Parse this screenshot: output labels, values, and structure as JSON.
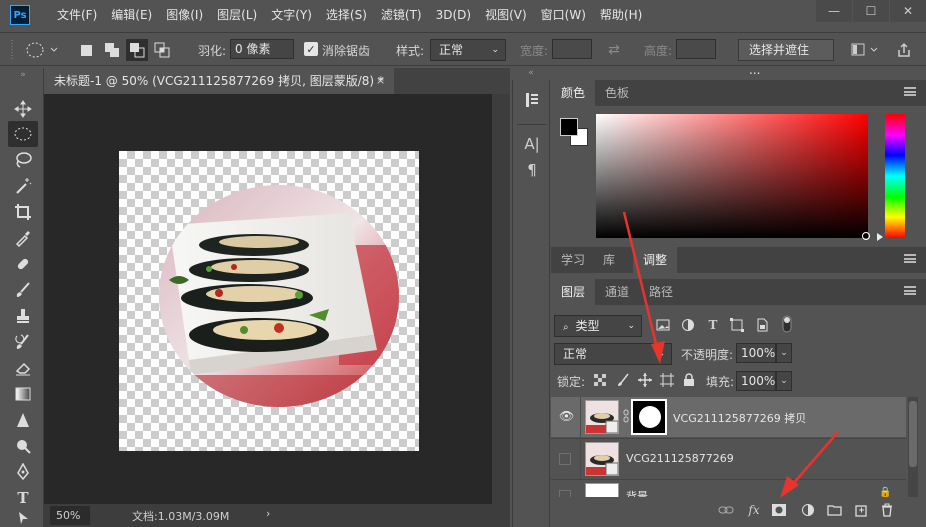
{
  "app": {
    "logo": "Ps"
  },
  "menu": [
    "文件(F)",
    "编辑(E)",
    "图像(I)",
    "图层(L)",
    "文字(Y)",
    "选择(S)",
    "滤镜(T)",
    "3D(D)",
    "视图(V)",
    "窗口(W)",
    "帮助(H)"
  ],
  "window_controls": {
    "minimize": "—",
    "maximize": "☐",
    "close": "✕"
  },
  "options": {
    "feather_label": "羽化:",
    "feather_value": "0 像素",
    "antialias_label": "消除锯齿",
    "antialias_checked": true,
    "style_label": "样式:",
    "style_value": "正常",
    "width_label": "宽度:",
    "height_label": "高度:",
    "select_mask_button": "选择并遮住 ..."
  },
  "document": {
    "tab_title": "未标题-1 @ 50% (VCG211125877269 拷贝, 图层蒙版/8) *",
    "close": "×",
    "zoom": "50%",
    "doc_info": "文档:1.03M/3.09M",
    "status_arrow": "›"
  },
  "color_panel": {
    "tabs": [
      "颜色",
      "色板"
    ],
    "active_tab": "颜色",
    "foreground": "#000000",
    "background": "#ffffff"
  },
  "learn_panel": {
    "tabs": [
      "学习",
      "库",
      "调整"
    ],
    "active_tab": "调整"
  },
  "layers_panel": {
    "tabs": [
      "图层",
      "通道",
      "路径"
    ],
    "active_tab": "图层",
    "filter_label": "类型",
    "blend_mode": "正常",
    "opacity_label": "不透明度:",
    "opacity_value": "100%",
    "lock_label": "锁定:",
    "fill_label": "填充:",
    "fill_value": "100%",
    "layers": [
      {
        "name": "VCG211125877269 拷贝",
        "visible": true,
        "has_mask": true,
        "selected": true
      },
      {
        "name": "VCG211125877269",
        "visible": false,
        "has_mask": false,
        "selected": false
      },
      {
        "name": "背景",
        "visible": false,
        "has_mask": false,
        "selected": false
      }
    ],
    "footer_icons": [
      "link-icon",
      "fx-icon",
      "mask-icon",
      "adjustment-icon",
      "folder-icon",
      "new-layer-icon",
      "trash-icon"
    ]
  },
  "mini_panel": {
    "text_tool": "A|",
    "paragraph": "¶"
  },
  "accent_colors": {
    "arrow": "#e8342c",
    "panel_bg": "#535353",
    "dark_bg": "#282828",
    "selected_layer": "#6a6a6a"
  }
}
